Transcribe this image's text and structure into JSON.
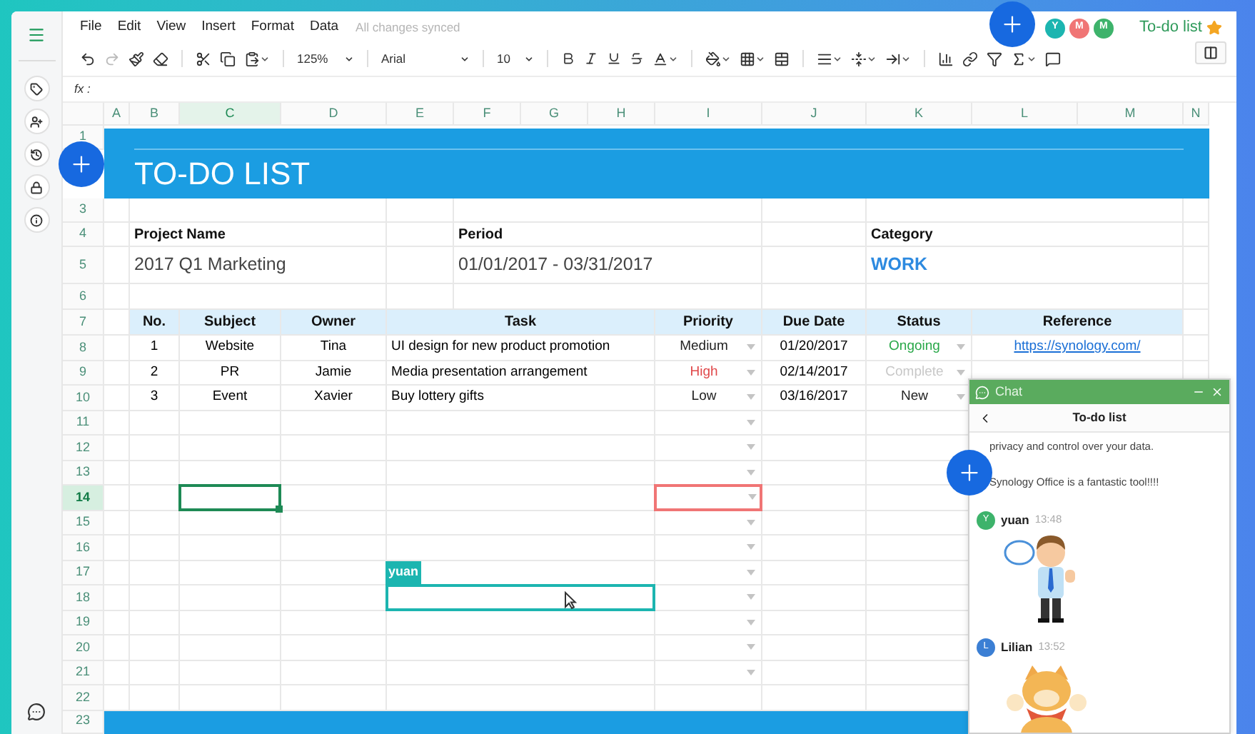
{
  "menu": [
    "File",
    "Edit",
    "View",
    "Insert",
    "Format",
    "Data"
  ],
  "sync_status": "All changes synced",
  "toolbar": {
    "zoom": "125%",
    "font": "Arial",
    "font_size": "10"
  },
  "collaborators": [
    {
      "initial": "Y",
      "color": "#1cb5b0"
    },
    {
      "initial": "M",
      "color": "#f07575"
    },
    {
      "initial": "M",
      "color": "#3db36b"
    }
  ],
  "document": {
    "title": "To-do list",
    "starred": true
  },
  "formula_bar": {
    "label": "fx :"
  },
  "columns": [
    {
      "label": "A",
      "selected": false
    },
    {
      "label": "B",
      "selected": false
    },
    {
      "label": "C",
      "selected": true
    },
    {
      "label": "D",
      "selected": false
    },
    {
      "label": "E",
      "selected": false
    },
    {
      "label": "F",
      "selected": false
    },
    {
      "label": "G",
      "selected": false
    },
    {
      "label": "H",
      "selected": false
    },
    {
      "label": "I",
      "selected": false
    },
    {
      "label": "J",
      "selected": false
    },
    {
      "label": "K",
      "selected": false
    },
    {
      "label": "L",
      "selected": false
    },
    {
      "label": "M",
      "selected": false
    },
    {
      "label": "N",
      "selected": false
    }
  ],
  "row_numbers": [
    {
      "label": "1",
      "selected": false
    },
    {
      "label": "3",
      "selected": false
    },
    {
      "label": "4",
      "selected": false
    },
    {
      "label": "5",
      "selected": false
    },
    {
      "label": "6",
      "selected": false
    },
    {
      "label": "7",
      "selected": false
    },
    {
      "label": "8",
      "selected": false
    },
    {
      "label": "9",
      "selected": false
    },
    {
      "label": "10",
      "selected": false
    },
    {
      "label": "11",
      "selected": false
    },
    {
      "label": "12",
      "selected": false
    },
    {
      "label": "13",
      "selected": false
    },
    {
      "label": "14",
      "selected": true
    },
    {
      "label": "15",
      "selected": false
    },
    {
      "label": "16",
      "selected": false
    },
    {
      "label": "17",
      "selected": false
    },
    {
      "label": "18",
      "selected": false
    },
    {
      "label": "19",
      "selected": false
    },
    {
      "label": "20",
      "selected": false
    },
    {
      "label": "21",
      "selected": false
    },
    {
      "label": "22",
      "selected": false
    },
    {
      "label": "23",
      "selected": false
    }
  ],
  "sheet": {
    "title": "TO-DO LIST",
    "project_label": "Project Name",
    "project": "2017 Q1 Marketing",
    "period_label": "Period",
    "period": "01/01/2017 - 03/31/2017",
    "category_label": "Category",
    "category": "WORK"
  },
  "table": {
    "columns": [
      "No.",
      "Subject",
      "Owner",
      "Task",
      "Priority",
      "Due Date",
      "Status",
      "Reference"
    ],
    "rows": [
      {
        "no": "1",
        "subject": "Website",
        "owner": "Tina",
        "task": "UI design for new product promotion",
        "priority": {
          "text": "Medium",
          "color": "#222222"
        },
        "due_date": "01/20/2017",
        "status": {
          "text": "Ongoing",
          "color": "#2aa84a"
        },
        "reference": "https://synology.com/"
      },
      {
        "no": "2",
        "subject": "PR",
        "owner": "Jamie",
        "task": "Media presentation arrangement",
        "priority": {
          "text": "High",
          "color": "#e0484a"
        },
        "due_date": "02/14/2017",
        "status": {
          "text": "Complete",
          "color": "#c8c8c8"
        }
      },
      {
        "no": "3",
        "subject": "Event",
        "owner": "Xavier",
        "task": "Buy lottery gifts",
        "priority": {
          "text": "Low",
          "color": "#222222"
        },
        "due_date": "03/16/2017",
        "status": {
          "text": "New",
          "color": "#222222"
        }
      }
    ]
  },
  "remote_cursors": [
    {
      "user": "yuan",
      "color": "#1cb5b0"
    },
    {
      "color": "#f07575"
    }
  ],
  "chat": {
    "title": "Chat",
    "conversation": "To-do list",
    "messages": [
      {
        "kind": "text",
        "text": "privacy and control over your data."
      },
      {
        "kind": "text",
        "text": "Synology Office is a fantastic tool!!!!"
      },
      {
        "kind": "sticker",
        "user": "yuan",
        "initial": "Y",
        "time": "13:48",
        "color": "#3db36b"
      },
      {
        "kind": "sticker",
        "user": "Lilian",
        "initial": "L",
        "time": "13:52",
        "color": "#3b7fd4"
      }
    ]
  }
}
